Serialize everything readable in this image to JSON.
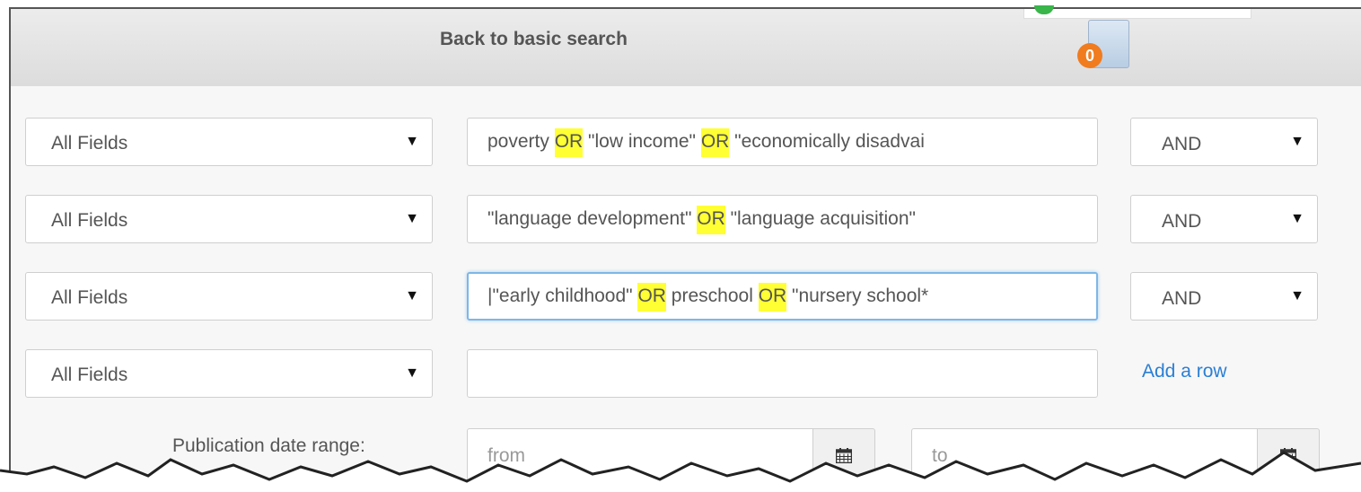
{
  "header": {
    "back_link": "Back to basic search",
    "cart_count": "0"
  },
  "rows": [
    {
      "field": "All Fields",
      "terms": [
        {
          "text": "poverty ",
          "hl": false
        },
        {
          "text": "OR",
          "hl": true
        },
        {
          "text": " \"low income\" ",
          "hl": false
        },
        {
          "text": "OR",
          "hl": true
        },
        {
          "text": " \"economically disadvai",
          "hl": false
        }
      ],
      "operator": "AND"
    },
    {
      "field": "All Fields",
      "terms": [
        {
          "text": "\"language development\" ",
          "hl": false
        },
        {
          "text": "OR",
          "hl": true
        },
        {
          "text": " \"language acquisition\"",
          "hl": false
        }
      ],
      "operator": "AND"
    },
    {
      "field": "All Fields",
      "terms": [
        {
          "text": "|\"early childhood\" ",
          "hl": false
        },
        {
          "text": "OR",
          "hl": true
        },
        {
          "text": " preschool ",
          "hl": false
        },
        {
          "text": "OR",
          "hl": true
        },
        {
          "text": " \"nursery school*",
          "hl": false
        }
      ],
      "operator": "AND",
      "focused": true
    },
    {
      "field": "All Fields",
      "terms": [],
      "operator": null
    }
  ],
  "add_row_label": "Add a row",
  "date_range": {
    "label": "Publication date range:",
    "from_placeholder": "from",
    "to_placeholder": "to"
  },
  "icons": {
    "dropdown": "caret-down-icon",
    "calendar": "calendar-icon",
    "cart": "folder-cart-icon"
  },
  "colors": {
    "highlight": "#ffff33",
    "link": "#2a7fd4",
    "badge": "#f07c1f",
    "focus_border": "#7eb6e6"
  }
}
